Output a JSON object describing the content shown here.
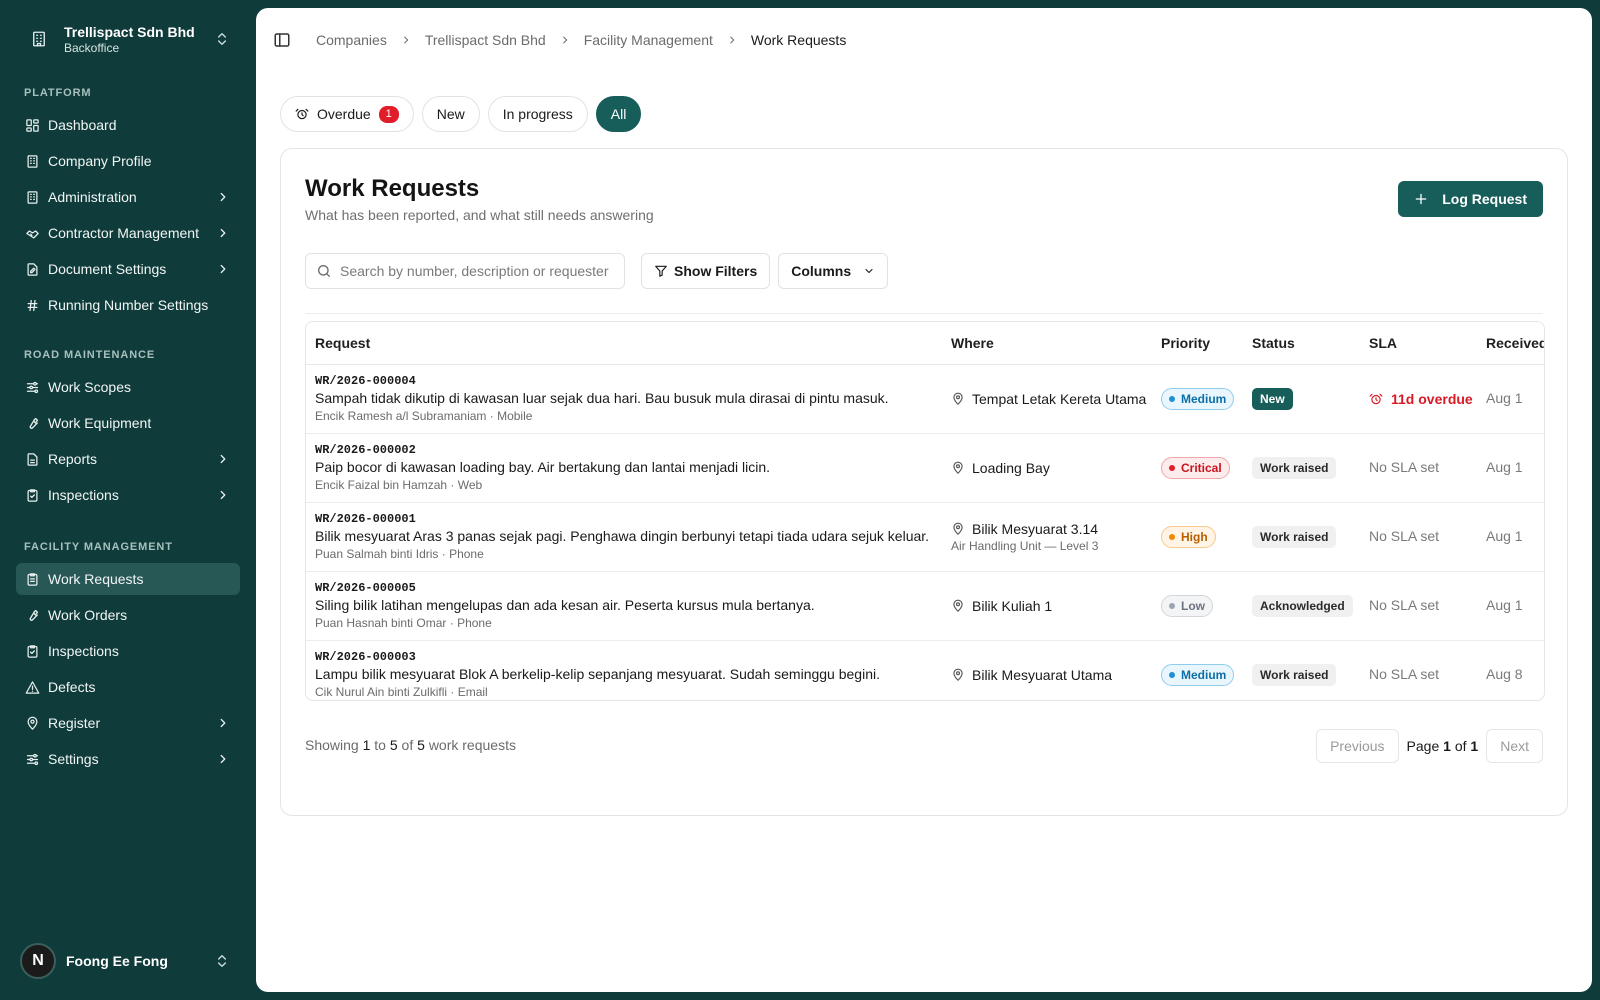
{
  "org": {
    "name": "Trellispact Sdn Bhd",
    "sub": "Backoffice",
    "icon": "building-icon"
  },
  "sidebar": {
    "sections": [
      {
        "label": "PLATFORM",
        "items": [
          {
            "label": "Dashboard",
            "icon": "dashboard-icon",
            "chevron": false
          },
          {
            "label": "Company Profile",
            "icon": "building-icon",
            "chevron": false
          },
          {
            "label": "Administration",
            "icon": "building-icon",
            "chevron": true
          },
          {
            "label": "Contractor Management",
            "icon": "handshake-icon",
            "chevron": true
          },
          {
            "label": "Document Settings",
            "icon": "document-edit-icon",
            "chevron": true
          },
          {
            "label": "Running Number Settings",
            "icon": "hash-icon",
            "chevron": false
          }
        ]
      },
      {
        "label": "ROAD MAINTENANCE",
        "items": [
          {
            "label": "Work Scopes",
            "icon": "sliders-icon",
            "chevron": false
          },
          {
            "label": "Work Equipment",
            "icon": "wrench-icon",
            "chevron": false
          },
          {
            "label": "Reports",
            "icon": "file-text-icon",
            "chevron": true
          },
          {
            "label": "Inspections",
            "icon": "clipboard-check-icon",
            "chevron": true
          }
        ]
      },
      {
        "label": "FACILITY MANAGEMENT",
        "items": [
          {
            "label": "Work Requests",
            "icon": "clipboard-list-icon",
            "chevron": false,
            "active": true
          },
          {
            "label": "Work Orders",
            "icon": "wrench-icon",
            "chevron": false
          },
          {
            "label": "Inspections",
            "icon": "clipboard-check-icon",
            "chevron": false
          },
          {
            "label": "Defects",
            "icon": "warning-triangle-icon",
            "chevron": false
          },
          {
            "label": "Register",
            "icon": "map-pin-icon",
            "chevron": true
          },
          {
            "label": "Settings",
            "icon": "sliders-icon",
            "chevron": true
          }
        ]
      }
    ]
  },
  "user": {
    "initial": "N",
    "name": "Foong Ee Fong"
  },
  "breadcrumb": [
    "Companies",
    "Trellispact Sdn Bhd",
    "Facility Management",
    "Work Requests"
  ],
  "chips": [
    {
      "label": "Overdue",
      "count": "1",
      "icon": "alarm-clock-icon"
    },
    {
      "label": "New"
    },
    {
      "label": "In progress"
    },
    {
      "label": "All",
      "active": true
    }
  ],
  "card": {
    "title": "Work Requests",
    "subtitle": "What has been reported, and what still needs answering",
    "log_button": "Log Request"
  },
  "toolbar": {
    "search_placeholder": "Search by number, description or requester",
    "filters_label": "Show Filters",
    "columns_label": "Columns"
  },
  "table": {
    "headers": [
      "Request",
      "Where",
      "Priority",
      "Status",
      "SLA",
      "Received"
    ],
    "rows": [
      {
        "number": "WR/2026-000004",
        "desc": "Sampah tidak dikutip di kawasan luar sejak dua hari. Bau busuk mula dirasai di pintu masuk.",
        "meta": "Encik Ramesh a/l Subramaniam · Mobile",
        "where": "Tempat Letak Kereta Utama",
        "where_sub": "",
        "priority": "Medium",
        "status": "New",
        "sla": "11d overdue",
        "sla_overdue": true,
        "received": "Aug 1"
      },
      {
        "number": "WR/2026-000002",
        "desc": "Paip bocor di kawasan loading bay. Air bertakung dan lantai menjadi licin.",
        "meta": "Encik Faizal bin Hamzah · Web",
        "where": "Loading Bay",
        "where_sub": "",
        "priority": "Critical",
        "status": "Work raised",
        "sla": "No SLA set",
        "sla_overdue": false,
        "received": "Aug 1"
      },
      {
        "number": "WR/2026-000001",
        "desc": "Bilik mesyuarat Aras 3 panas sejak pagi. Penghawa dingin berbunyi tetapi tiada udara sejuk keluar.",
        "meta": "Puan Salmah binti Idris · Phone",
        "where": "Bilik Mesyuarat 3.14",
        "where_sub": "Air Handling Unit — Level 3",
        "priority": "High",
        "status": "Work raised",
        "sla": "No SLA set",
        "sla_overdue": false,
        "received": "Aug 1"
      },
      {
        "number": "WR/2026-000005",
        "desc": "Siling bilik latihan mengelupas dan ada kesan air. Peserta kursus mula bertanya.",
        "meta": "Puan Hasnah binti Omar · Phone",
        "where": "Bilik Kuliah 1",
        "where_sub": "",
        "priority": "Low",
        "status": "Acknowledged",
        "sla": "No SLA set",
        "sla_overdue": false,
        "received": "Aug 1"
      },
      {
        "number": "WR/2026-000003",
        "desc": "Lampu bilik mesyuarat Blok A berkelip-kelip sepanjang mesyuarat. Sudah seminggu begini.",
        "meta": "Cik Nurul Ain binti Zulkifli · Email",
        "where": "Bilik Mesyuarat Utama",
        "where_sub": "",
        "priority": "Medium",
        "status": "Work raised",
        "sla": "No SLA set",
        "sla_overdue": false,
        "received": "Aug 8"
      }
    ]
  },
  "priority_colors": {
    "Medium": {
      "fg": "#0b6fa6",
      "bg": "#eaf6fd",
      "border": "#8fcdee",
      "dot": "#1e90d6"
    },
    "Critical": {
      "fg": "#c8141f",
      "bg": "#fdecec",
      "border": "#f2a5a8",
      "dot": "#e11d2a"
    },
    "High": {
      "fg": "#b85e00",
      "bg": "#fff4e6",
      "border": "#f7c98a",
      "dot": "#f08a00"
    },
    "Low": {
      "fg": "#6b7280",
      "bg": "#f3f4f6",
      "border": "#d4d6da",
      "dot": "#9ca3af"
    }
  },
  "footer": {
    "prefix": "Showing",
    "from": "1",
    "to_word": "to",
    "to": "5",
    "of_word": "of",
    "total": "5",
    "suffix": "work requests"
  },
  "pager": {
    "prev": "Previous",
    "page_word": "Page",
    "page": "1",
    "of_word": "of",
    "pages": "1",
    "next": "Next"
  }
}
